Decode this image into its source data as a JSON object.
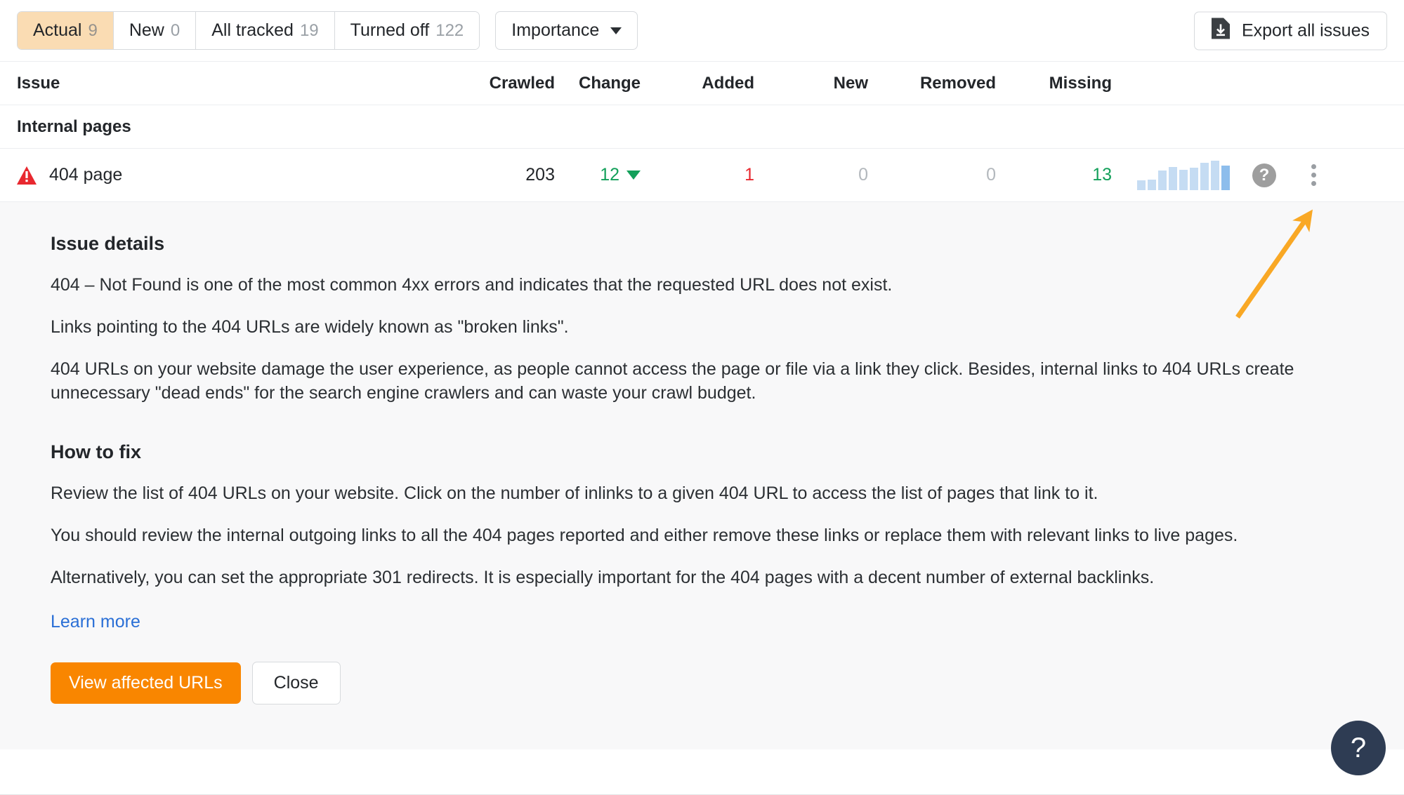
{
  "toolbar": {
    "tabs": [
      {
        "label": "Actual",
        "count": "9",
        "active": true
      },
      {
        "label": "New",
        "count": "0",
        "active": false
      },
      {
        "label": "All tracked",
        "count": "19",
        "active": false
      },
      {
        "label": "Turned off",
        "count": "122",
        "active": false
      }
    ],
    "filter": {
      "label": "Importance"
    },
    "export": {
      "label": "Export all issues",
      "icon": "download-file-icon"
    }
  },
  "table": {
    "columns": [
      "Issue",
      "Crawled",
      "Change",
      "Added",
      "New",
      "Removed",
      "Missing"
    ],
    "groups": [
      {
        "label": "Internal pages",
        "rows": [
          {
            "icon": "error-warning-icon",
            "issue": "404 page",
            "crawled": "203",
            "change": "12",
            "change_direction": "down",
            "added": "1",
            "new": "0",
            "removed": "0",
            "missing": "13",
            "sparkline": [
              12,
              13,
              24,
              28,
              25,
              27,
              33,
              36,
              30
            ],
            "help_icon": "question-mark-icon",
            "menu_icon": "kebab-menu-icon"
          }
        ]
      }
    ]
  },
  "detail": {
    "issue_details_heading": "Issue details",
    "issue_details_paragraphs": [
      "404 – Not Found is one of the most common 4xx errors and indicates that the requested URL does not exist.",
      "Links pointing to the 404 URLs are widely known as \"broken links\".",
      "404 URLs on your website damage the user experience, as people cannot access the page or file via a link they click. Besides, internal links to 404 URLs create unnecessary \"dead ends\" for the search engine crawlers and can waste your crawl budget."
    ],
    "how_to_fix_heading": "How to fix",
    "how_to_fix_paragraphs": [
      "Review the list of 404 URLs on your website. Click on the number of inlinks to a given 404 URL to access the list of pages that link to it.",
      "You should review the internal outgoing links to all the 404 pages reported and either remove these links or replace them with relevant links to live pages.",
      "Alternatively, you can set the appropriate 301 redirects. It is especially important for the 404 pages with a decent number of external backlinks."
    ],
    "learn_more": "Learn more",
    "primary_button": "View affected URLs",
    "secondary_button": "Close"
  },
  "support_fab": {
    "icon": "question-mark-icon",
    "label": "?"
  },
  "annotation": {
    "type": "arrow",
    "color": "#f9a825",
    "points_to": "row-help-icon"
  },
  "colors": {
    "accent_orange": "#f98600",
    "active_tab_bg": "#fadcb3",
    "positive_green": "#13a05a",
    "negative_red": "#e8282f",
    "muted_grey": "#b3b8bd",
    "link_blue": "#2a6fd6",
    "fab_navy": "#2e3c53",
    "annotation_orange": "#f9a825"
  }
}
